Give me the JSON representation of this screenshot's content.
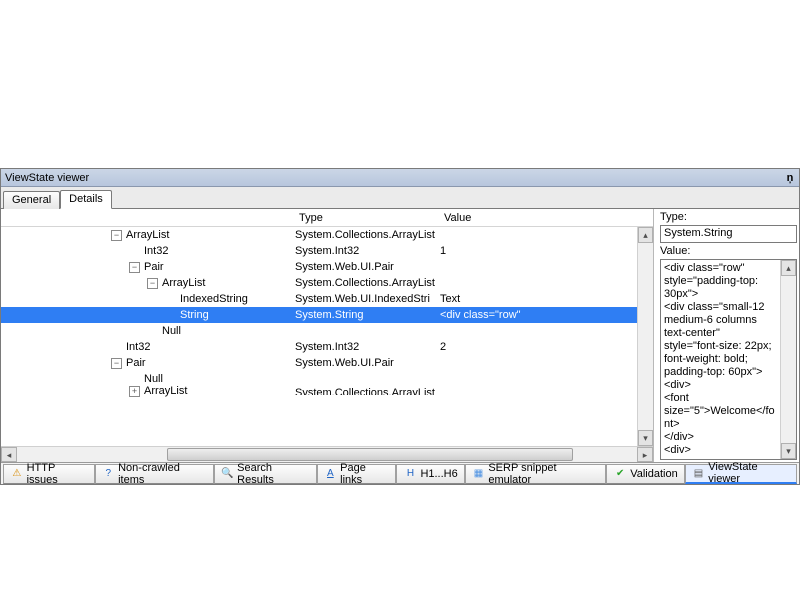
{
  "panel": {
    "title": "ViewState viewer",
    "pin_glyph": "ņ"
  },
  "tabs": {
    "general": "General",
    "details": "Details",
    "active": "details"
  },
  "columns": {
    "type": "Type",
    "value": "Value"
  },
  "tree": {
    "rows": [
      {
        "indent": 3,
        "expander": "-",
        "label": "ArrayList",
        "type": "System.Collections.ArrayList",
        "value": "",
        "selected": false
      },
      {
        "indent": 4,
        "expander": "",
        "label": "Int32",
        "type": "System.Int32",
        "value": "1",
        "selected": false
      },
      {
        "indent": 4,
        "expander": "-",
        "label": "Pair",
        "type": "System.Web.UI.Pair",
        "value": "",
        "selected": false
      },
      {
        "indent": 5,
        "expander": "-",
        "label": "ArrayList",
        "type": "System.Collections.ArrayList",
        "value": "",
        "selected": false
      },
      {
        "indent": 6,
        "expander": "",
        "label": "IndexedString",
        "type": "System.Web.UI.IndexedStri",
        "value": "Text",
        "selected": false
      },
      {
        "indent": 6,
        "expander": "",
        "label": "String",
        "type": "System.String",
        "value": "<div class=\"row\"",
        "selected": true
      },
      {
        "indent": 5,
        "expander": "",
        "label": "Null",
        "type": "",
        "value": "",
        "selected": false
      },
      {
        "indent": 3,
        "expander": "",
        "label": "Int32",
        "type": "System.Int32",
        "value": "2",
        "selected": false
      },
      {
        "indent": 3,
        "expander": "-",
        "label": "Pair",
        "type": "System.Web.UI.Pair",
        "value": "",
        "selected": false
      },
      {
        "indent": 4,
        "expander": "",
        "label": "Null",
        "type": "",
        "value": "",
        "selected": false
      },
      {
        "indent": 4,
        "expander": "+",
        "label": "ArrayList",
        "type": "System.Collections.ArrayList",
        "value": "",
        "selected": false,
        "clipped": true
      }
    ]
  },
  "details": {
    "type_label": "Type:",
    "type_value": "System.String",
    "value_label": "Value:",
    "value_text": "<div class=\"row\" style=\"padding-top: 30px\">\n<div class=\"small-12 medium-6 columns text-center\" style=\"font-size: 22px; font-weight: bold; padding-top: 60px\">\n<div>\n<font size=\"5\">Welcome</font>\n</div>\n<div>"
  },
  "bottom_tabs": [
    {
      "id": "http-issues",
      "label": "HTTP issues",
      "icon": "⚠",
      "icon_color": "#d68a00"
    },
    {
      "id": "non-crawled",
      "label": "Non-crawled items",
      "icon": "?",
      "icon_color": "#1e63c4"
    },
    {
      "id": "search",
      "label": "Search Results",
      "icon": "🔍",
      "icon_color": "#5a5a5a"
    },
    {
      "id": "page-links",
      "label": "Page links",
      "icon": "A",
      "icon_color": "#1e63c4",
      "underline": true
    },
    {
      "id": "h1-h6",
      "label": "H1...H6",
      "icon": "H",
      "icon_color": "#1e63c4"
    },
    {
      "id": "serp",
      "label": "SERP snippet emulator",
      "icon": "▦",
      "icon_color": "#4a90e2"
    },
    {
      "id": "validation",
      "label": "Validation",
      "icon": "✔",
      "icon_color": "#2aa52a"
    },
    {
      "id": "viewstate",
      "label": "ViewState viewer",
      "icon": "▤",
      "icon_color": "#5a5a5a",
      "active": true
    }
  ]
}
